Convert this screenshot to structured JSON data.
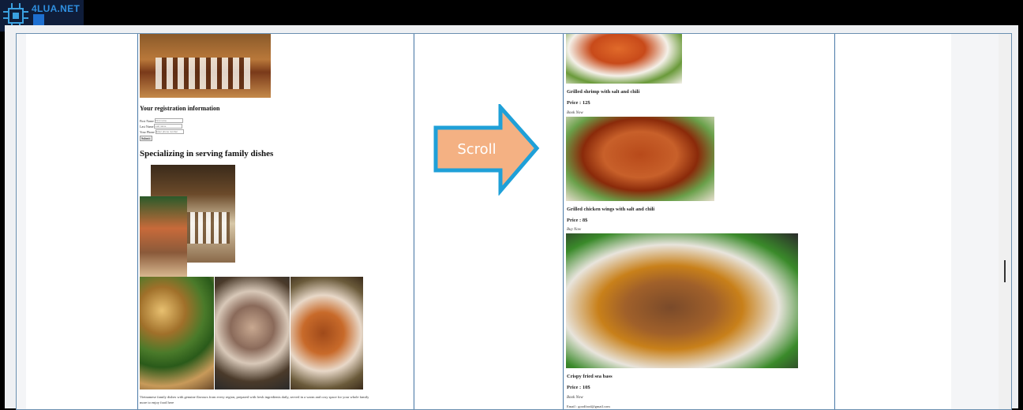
{
  "logo": {
    "text": "4LUA.NET"
  },
  "left_page": {
    "registration_heading": "Your registration information",
    "form": {
      "first_name_label": "First Name",
      "first_name_placeholder": "First name",
      "last_name_label": "Last Name",
      "last_name_placeholder": "Last name",
      "phone_label": "Your Phone",
      "phone_placeholder": "Enter phone number",
      "submit_label": "Submit"
    },
    "section_heading": "Specializing in serving family dishes",
    "footer_text_line1": "Vietnamese family dishes with genuine flavours from every region, prepared with fresh ingredients daily, served in a warm and cosy space for your whole family",
    "footer_text_line2": "more to enjoy food here"
  },
  "arrow": {
    "label": "Scroll",
    "fill": "#f4b183",
    "stroke": "#1fa0d8"
  },
  "right_page": {
    "items": [
      {
        "name": "Grilled shrimp with salt and chili",
        "price": "Price : 12$",
        "link": "Book Now"
      },
      {
        "name": "Grilled chicken wings with salt and chili",
        "price": "Price : 8$",
        "link": "Buy Now"
      },
      {
        "name": "Crispy fried sea bass",
        "price": "Price : 10$",
        "link": "Book Now"
      }
    ],
    "email_line": "Email : goodfood@gmail.com"
  }
}
